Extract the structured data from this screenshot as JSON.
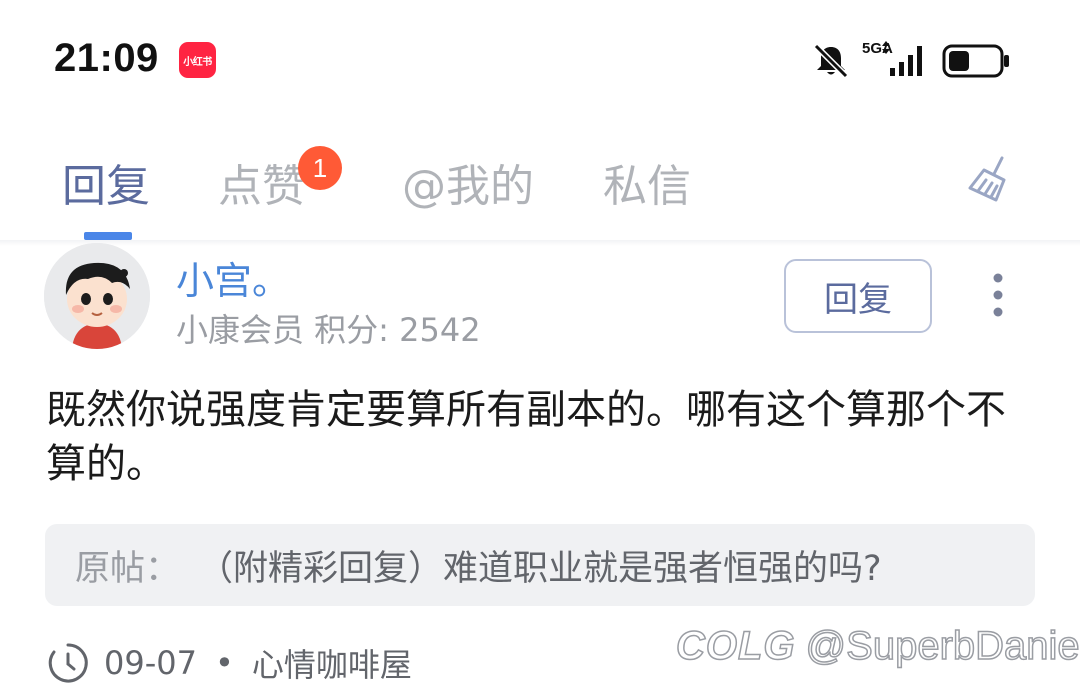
{
  "status_bar": {
    "time": "21:09",
    "app_badge": "小红书",
    "network": "5GA",
    "icons": [
      "bell-muted-icon",
      "signal-icon",
      "battery-icon"
    ]
  },
  "tabs": [
    {
      "label": "回复",
      "active": true
    },
    {
      "label": "点赞",
      "active": false,
      "badge": "1"
    },
    {
      "label": "@我的",
      "active": false
    },
    {
      "label": "私信",
      "active": false
    }
  ],
  "tabs_action_icon": "broom-icon",
  "comment": {
    "username": "小宫。",
    "meta": "小康会员 积分: 2542",
    "reply_label": "回复",
    "text": "既然你说强度肯定要算所有副本的。哪有这个算那个不算的。",
    "original_post_label": "原帖：",
    "original_post_title": "（附精彩回复）难道职业就是强者恒强的吗?",
    "date": "09-07",
    "separator": "•",
    "board": "心情咖啡屋"
  },
  "watermark": {
    "logo": "COLG",
    "handle": "@SuperbDaniel"
  },
  "colors": {
    "accent": "#4a86e8",
    "active_tab": "#5b6b9e",
    "inactive_tab": "#b0b3b8",
    "badge": "#ff5a36",
    "brand_red": "#ff2442"
  }
}
